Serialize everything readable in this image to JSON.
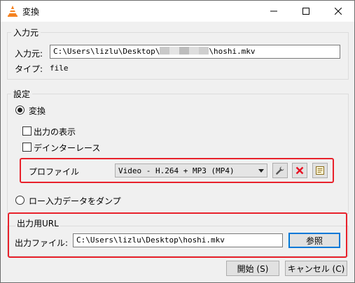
{
  "window": {
    "title": "変換",
    "icon": "vlc-cone-icon",
    "controls": [
      "minimize-icon",
      "maximize-icon",
      "close-icon"
    ]
  },
  "source": {
    "group_title": "入力元",
    "input_label": "入力元:",
    "path_prefix": "C:\\Users\\lizlu\\Desktop\\",
    "path_suffix": "\\hoshi.mkv",
    "type_label": "タイプ:",
    "type_value": "file"
  },
  "settings": {
    "group_title": "設定",
    "convert_label": "変換",
    "convert_selected": true,
    "show_output_label": "出力の表示",
    "show_output_checked": false,
    "deinterlace_label": "デインターレース",
    "deinterlace_checked": false,
    "profile_label": "プロファイル",
    "profile_value": "Video - H.264 + MP3 (MP4)",
    "dump_label": "ロー入力データをダンプ",
    "dump_selected": false
  },
  "destination": {
    "group_title": "出力用URL",
    "file_label": "出力ファイル:",
    "file_value": "C:\\Users\\lizlu\\Desktop\\hoshi.mkv",
    "browse_label": "参照"
  },
  "footer": {
    "start_label": "開始 (S)",
    "cancel_label": "キャンセル (C)"
  },
  "colors": {
    "highlight_frame": "#e8212b",
    "delete_icon": "#e81123",
    "default_button_border": "#0078d7"
  }
}
